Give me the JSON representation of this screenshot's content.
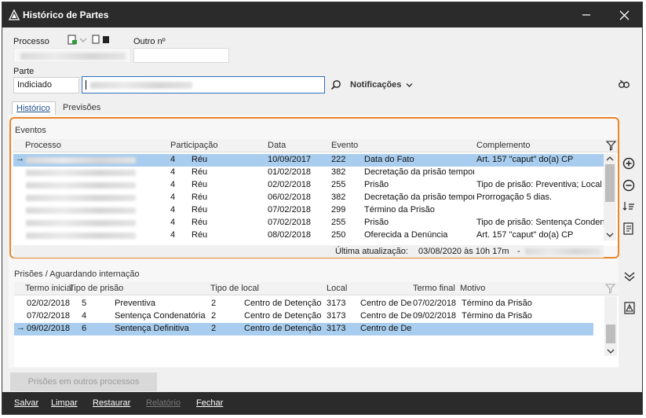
{
  "window": {
    "title": "Histórico de Partes"
  },
  "form": {
    "processo_label": "Processo",
    "outro_label": "Outro nº",
    "parte_label": "Parte",
    "parte_tipo": "Indiciado",
    "notificacoes_label": "Notificações"
  },
  "tabs": [
    {
      "label": "Histórico"
    },
    {
      "label": "Previsões"
    }
  ],
  "events": {
    "section_title": "Eventos",
    "columns": [
      "Processo",
      "Participação",
      "Data",
      "Evento",
      "Complemento"
    ],
    "rows": [
      {
        "n": "4",
        "participacao": "Réu",
        "data": "10/09/2017",
        "codigo": "222",
        "evento": "Data do Fato",
        "complemento": "Art. 157 \"caput\" do(a) CP",
        "selected": true
      },
      {
        "n": "4",
        "participacao": "Réu",
        "data": "01/02/2018",
        "codigo": "382",
        "evento": "Decretação da prisão temporária",
        "complemento": ""
      },
      {
        "n": "4",
        "participacao": "Réu",
        "data": "02/02/2018",
        "codigo": "255",
        "evento": "Prisão",
        "complemento": "Tipo de prisão: Preventiva; Local"
      },
      {
        "n": "4",
        "participacao": "Réu",
        "data": "06/02/2018",
        "codigo": "382",
        "evento": "Decretação da prisão temporária",
        "complemento": "Prorrogação 5 dias."
      },
      {
        "n": "4",
        "participacao": "Réu",
        "data": "07/02/2018",
        "codigo": "299",
        "evento": "Término da Prisão",
        "complemento": ""
      },
      {
        "n": "4",
        "participacao": "Réu",
        "data": "07/02/2018",
        "codigo": "255",
        "evento": "Prisão",
        "complemento": "Tipo de prisão: Sentença Condenatória"
      },
      {
        "n": "4",
        "participacao": "Réu",
        "data": "08/02/2018",
        "codigo": "250",
        "evento": "Oferecida a Denúncia",
        "complemento": "Art. 157 \"caput\" do(a) CP"
      }
    ],
    "ultima_atualizacao_label": "Última atualização:",
    "ultima_atualizacao_value": "03/08/2020 às 10h 17m",
    "separator": "-"
  },
  "prisoes": {
    "section_title": "Prisões / Aguardando internação",
    "columns": [
      "Termo inicial",
      "Tipo de prisão",
      "Tipo de local",
      "Local",
      "Termo final",
      "Motivo"
    ],
    "rows": [
      {
        "termo_inicial": "02/02/2018",
        "tipo_cod": "5",
        "tipo": "Preventiva",
        "local_cod": "2",
        "tipo_local": "Centro de Detenção",
        "local_num": "3173",
        "local": "Centro de De",
        "termo_final": "07/02/2018",
        "motivo": "Término da Prisão"
      },
      {
        "termo_inicial": "07/02/2018",
        "tipo_cod": "4",
        "tipo": "Sentença Condenatória",
        "local_cod": "2",
        "tipo_local": "Centro de Detenção",
        "local_num": "3173",
        "local": "Centro de De",
        "termo_final": "09/02/2018",
        "motivo": "Término da Prisão"
      },
      {
        "termo_inicial": "09/02/2018",
        "tipo_cod": "6",
        "tipo": "Sentença Definitiva",
        "local_cod": "2",
        "tipo_local": "Centro de Detenção",
        "local_num": "3173",
        "local": "Centro de De",
        "termo_final": "",
        "motivo": "",
        "selected": true
      }
    ]
  },
  "buttons": {
    "outros_processos": "Prisões em outros processos",
    "salvar": "Salvar",
    "limpar": "Limpar",
    "restaurar": "Restaurar",
    "relatorio": "Relatório",
    "fechar": "Fechar"
  },
  "colors": {
    "title_bar": "#2b2b2b",
    "highlight_border": "#e8862a",
    "selected_row": "#a9cdee",
    "input_focus": "#2f6fbf"
  },
  "icons": [
    "app-logo-icon",
    "minimize-icon",
    "close-icon",
    "search-icon",
    "chevron-down-icon",
    "link-icon",
    "filter-icon",
    "add-icon",
    "remove-icon",
    "sort-list-icon",
    "report-icon",
    "collapse-icon",
    "warning-doc-icon"
  ]
}
